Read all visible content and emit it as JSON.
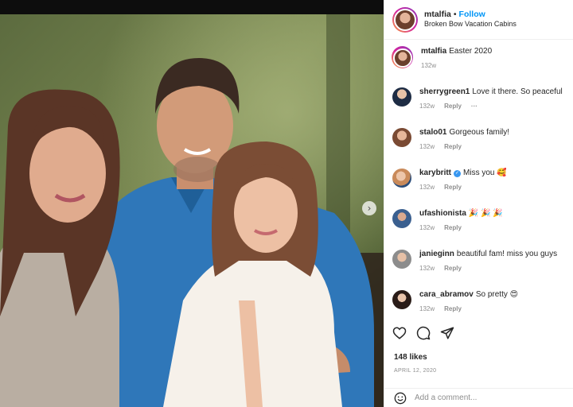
{
  "post": {
    "username": "mtalfia",
    "follow_label": "Follow",
    "location": "Broken Bow Vacation Cabins",
    "likes": "148 likes",
    "date": "APRIL 12, 2020",
    "add_comment_placeholder": "Add a comment..."
  },
  "caption": {
    "username": "mtalfia",
    "text": "Easter 2020",
    "time": "132w"
  },
  "comments": [
    {
      "username": "sherrygreen1",
      "text": "Love it there. So peaceful",
      "time": "132w",
      "reply": "Reply",
      "more": "···"
    },
    {
      "username": "stalo01",
      "text": "Gorgeous family!",
      "time": "132w",
      "reply": "Reply"
    },
    {
      "username": "karybritt",
      "text": "Miss you 🥰",
      "time": "132w",
      "reply": "Reply",
      "verified": true
    },
    {
      "username": "ufashionista",
      "text": "🎉 🎉 🎉",
      "time": "132w",
      "reply": "Reply"
    },
    {
      "username": "janieginn",
      "text": "beautiful fam! miss you guys",
      "time": "132w",
      "reply": "Reply"
    },
    {
      "username": "cara_abramov",
      "text": "So pretty 😍",
      "time": "132w",
      "reply": "Reply"
    }
  ],
  "icons": {
    "like": "heart-icon",
    "comment": "comment-icon",
    "share": "send-icon",
    "next": "chevron-right-icon",
    "emoji": "smiley-icon"
  },
  "colors": {
    "accent": "#0095f6",
    "muted": "#8e8e8e",
    "verified": "#3897f0"
  }
}
